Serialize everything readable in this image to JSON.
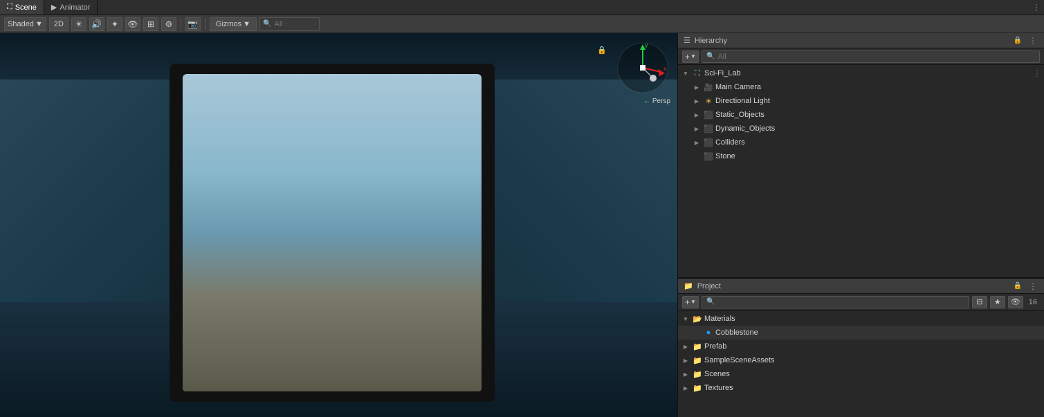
{
  "tabs": [
    {
      "label": "Scene",
      "icon": "⛶",
      "active": true
    },
    {
      "label": "Animator",
      "icon": "▶",
      "active": false
    }
  ],
  "toolbar": {
    "shading": "Shaded",
    "mode_2d": "2D",
    "gizmos": "Gizmos",
    "all_label": "All",
    "search_placeholder": "All"
  },
  "scene": {
    "gizmo_persp": "← Persp",
    "axes": {
      "y": "y",
      "x": "x"
    }
  },
  "hierarchy": {
    "title": "Hierarchy",
    "search_placeholder": "All",
    "root": "Sci-Fi_Lab",
    "items": [
      {
        "label": "Sci-Fi_Lab",
        "indent": 0,
        "expanded": true,
        "icon": "scene"
      },
      {
        "label": "Main Camera",
        "indent": 1,
        "expanded": false,
        "icon": "camera"
      },
      {
        "label": "Directional Light",
        "indent": 1,
        "expanded": false,
        "icon": "light"
      },
      {
        "label": "Static_Objects",
        "indent": 1,
        "expanded": false,
        "icon": "cube"
      },
      {
        "label": "Dynamic_Objects",
        "indent": 1,
        "expanded": false,
        "icon": "cube"
      },
      {
        "label": "Colliders",
        "indent": 1,
        "expanded": false,
        "icon": "cube"
      },
      {
        "label": "Stone",
        "indent": 1,
        "expanded": false,
        "icon": "cube"
      }
    ]
  },
  "project": {
    "title": "Project",
    "search_placeholder": "",
    "count": "16",
    "items": [
      {
        "label": "Materials",
        "indent": 0,
        "expanded": true,
        "icon": "folder"
      },
      {
        "label": "Cobblestone",
        "indent": 1,
        "expanded": false,
        "icon": "material"
      },
      {
        "label": "Prefab",
        "indent": 0,
        "expanded": false,
        "icon": "folder"
      },
      {
        "label": "SampleSceneAssets",
        "indent": 0,
        "expanded": false,
        "icon": "folder"
      },
      {
        "label": "Scenes",
        "indent": 0,
        "expanded": false,
        "icon": "folder"
      },
      {
        "label": "Textures",
        "indent": 0,
        "expanded": false,
        "icon": "folder"
      }
    ]
  }
}
